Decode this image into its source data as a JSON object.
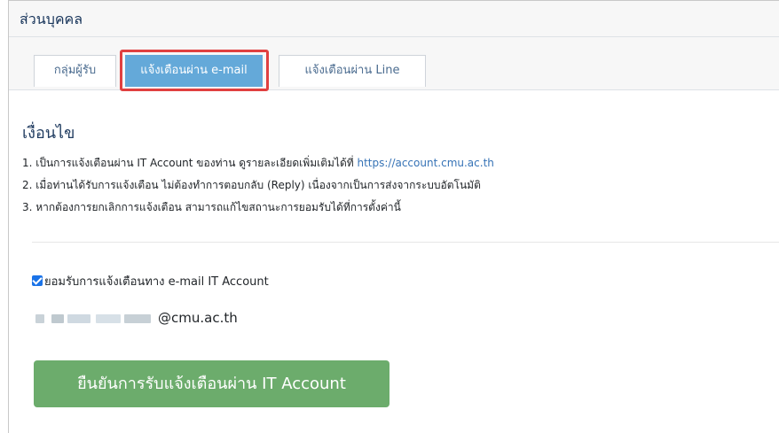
{
  "header": {
    "title": "ส่วนบุคคล"
  },
  "tabs": [
    {
      "label": "กลุ่มผู้รับ",
      "active": false
    },
    {
      "label": "แจ้งเตือนผ่าน e-mail",
      "active": true
    },
    {
      "label": "แจ้งเตือนผ่าน Line",
      "active": false
    }
  ],
  "conditions": {
    "title": "เงื่อนไข",
    "items": [
      {
        "text": "1. เป็นการแจ้งเตือนผ่าน IT Account ของท่าน ดูรายละเอียดเพิ่มเติมได้ที่ ",
        "link": "https://account.cmu.ac.th"
      },
      {
        "text": "2. เมื่อท่านได้รับการแจ้งเตือน ไม่ต้องทำการตอบกลับ (Reply) เนื่องจากเป็นการส่งจากระบบอัตโนมัติ"
      },
      {
        "text": "3. หากต้องการยกเลิกการแจ้งเตือน สามารถแก้ไขสถานะการยอมรับได้ที่การตั้งค่านี้"
      }
    ]
  },
  "consent": {
    "checked": true,
    "label": "ยอมรับการแจ้งเตือนทาง e-mail IT Account"
  },
  "email": {
    "domain": "@cmu.ac.th"
  },
  "confirm_button": {
    "label": "ยืนยันการรับแจ้งเตือนผ่าน IT Account"
  },
  "colors": {
    "active_tab": "#64a9d9",
    "tab_highlight": "#e04040",
    "link": "#3673b6",
    "confirm_button": "#6cac6c",
    "checkbox": "#1a73e8"
  }
}
